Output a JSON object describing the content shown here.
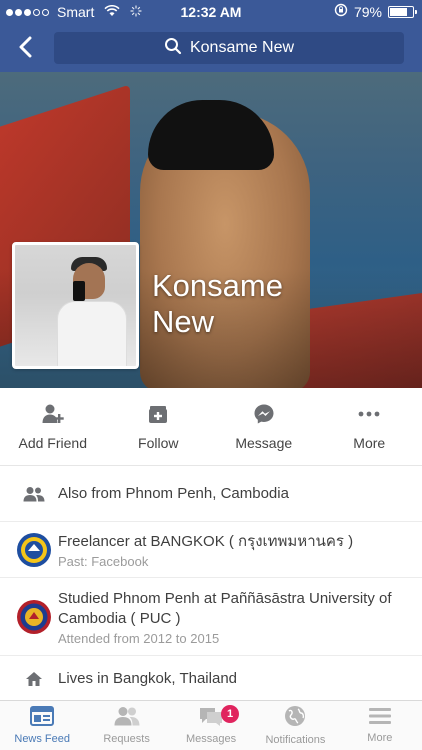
{
  "status_bar": {
    "carrier": "Smart",
    "time": "12:32 AM",
    "battery_percent_text": "79%",
    "battery_level": 0.79,
    "signal_bars_filled": 3,
    "signal_bars_total": 5
  },
  "nav": {
    "search_text": "Konsame New"
  },
  "profile": {
    "name_line1": "Konsame",
    "name_line2": "New"
  },
  "actions": [
    {
      "label": "Add Friend",
      "icon": "add-friend-icon"
    },
    {
      "label": "Follow",
      "icon": "follow-icon"
    },
    {
      "label": "Message",
      "icon": "messenger-icon"
    },
    {
      "label": "More",
      "icon": "more-dots-icon"
    }
  ],
  "about": {
    "from": "Also from Phnom Penh, Cambodia",
    "work": {
      "title": "Freelancer at BANGKOK ( กรุงเทพมหานคร )",
      "sub": "Past: Facebook"
    },
    "education": {
      "title": "Studied Phnom Penh at Paññāsāstra University of Cambodia ( PUC )",
      "sub": "Attended from 2012 to 2015"
    },
    "lives": "Lives in Bangkok, Thailand"
  },
  "tabs": [
    {
      "label": "News Feed",
      "icon": "news-feed-icon",
      "active": true
    },
    {
      "label": "Requests",
      "icon": "friend-requests-icon"
    },
    {
      "label": "Messages",
      "icon": "messages-icon",
      "badge": "1"
    },
    {
      "label": "Notifications",
      "icon": "globe-icon"
    },
    {
      "label": "More",
      "icon": "menu-icon"
    }
  ],
  "colors": {
    "brand_blue": "#3b5998",
    "active_tab": "#4a7ab6",
    "badge_red": "#e0245e"
  }
}
